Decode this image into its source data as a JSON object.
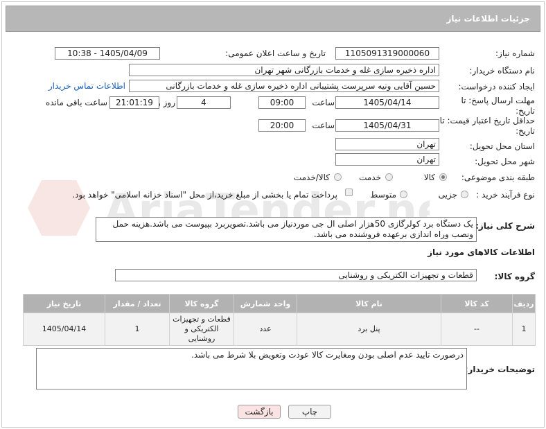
{
  "header": {
    "title": "جزئیات اطلاعات نیاز"
  },
  "fields": {
    "need_number_label": "شماره نیاز:",
    "need_number": "1105091319000060",
    "announce_label": "تاریخ و ساعت اعلان عمومی:",
    "announce_value": "1405/04/09 - 10:38",
    "buyer_org_label": "نام دستگاه خریدار:",
    "buyer_org": "اداره ذخیره سازی غله و خدمات بازرگانی شهر تهران",
    "requester_label": "ایجاد کننده درخواست:",
    "requester": "حسین آقایی ونیه سرپرست پشتیبانی اداره ذخیره سازی غله و خدمات بازرگانی",
    "contact_link": "اطلاعات تماس خریدار",
    "deadline_label": "مهلت ارسال پاسخ: تا تاریخ:",
    "deadline_date": "1405/04/14",
    "time_label": "ساعت",
    "deadline_time": "09:00",
    "days_value": "4",
    "days_label": "روز و",
    "remaining_time": "21:01:19",
    "remaining_label": "ساعت باقی مانده",
    "validity_label": "حداقل تاریخ اعتبار قیمت: تا تاریخ:",
    "validity_date": "1405/04/31",
    "validity_time_label": "ساعت",
    "validity_time": "20:00",
    "province_label": "استان محل تحویل:",
    "province": "تهران",
    "city_label": "شهر محل تحویل:",
    "city": "تهران",
    "category_label": "طبقه بندی موضوعی:",
    "category_options": [
      "کالا",
      "خدمت",
      "کالا/خدمت"
    ],
    "process_label": "نوع فرآیند خرید :",
    "process_options": [
      "جزیی",
      "متوسط"
    ],
    "payment_note": "پرداخت تمام یا بخشی از مبلغ خرید،از محل \"اسناد خزانه اسلامی\" خواهد بود."
  },
  "summary": {
    "label": "شرح کلی نیاز:",
    "text": "یک دستگاه برد کولرگازی 50هزار اصلی ال جی موردنیاز می باشد.تصویربرد بپیوست می باشد.هزینه حمل ونصب وراه اندازی برعهده فروشنده می باشد."
  },
  "goods_info_title": "اطلاعات کالاهای مورد نیاز",
  "goods_group": {
    "label": "گروه کالا:",
    "value": "قطعات و تجهیزات الکتریکی و روشنایی"
  },
  "table": {
    "headers": [
      "ردیف",
      "کد کالا",
      "نام کالا",
      "واحد شمارش",
      "گروه کالا",
      "تعداد / مقدار",
      "تاریخ نیاز"
    ],
    "rows": [
      [
        "1",
        "--",
        "پنل برد",
        "عدد",
        "قطعات و تجهیزات الکتریکی و روشنایی",
        "1",
        "1405/04/14"
      ]
    ]
  },
  "buyer_notes": {
    "label": "توضیحات خریدار:",
    "text": "درصورت تایید عدم اصلی بودن ومغایرت کالا عودت وتعویض بلا شرط می باشد."
  },
  "buttons": {
    "print": "چاپ",
    "back": "بازگشت"
  },
  "watermark_text": "AriaTender.net",
  "colors": {
    "header_bg": "#b7b7b7",
    "link": "#1a5fb4",
    "back_button_bg": "#fbe3e3"
  }
}
